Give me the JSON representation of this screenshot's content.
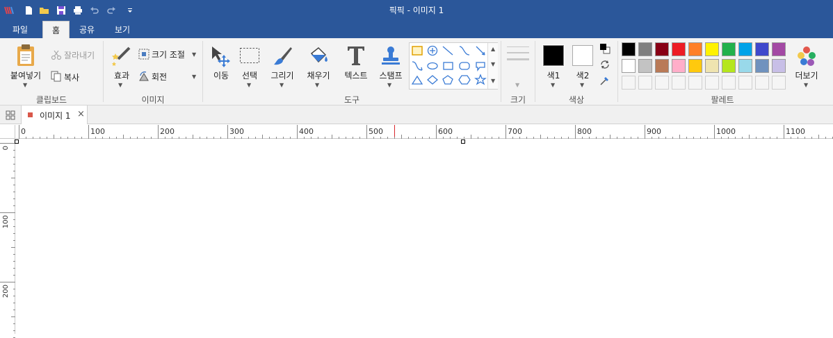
{
  "window": {
    "title": "픽픽 - 이미지 1"
  },
  "quick_access": [
    {
      "name": "app-logo-icon"
    },
    {
      "name": "new-file-icon"
    },
    {
      "name": "open-folder-icon"
    },
    {
      "name": "save-icon"
    },
    {
      "name": "print-icon"
    },
    {
      "name": "undo-icon"
    },
    {
      "name": "redo-icon"
    },
    {
      "name": "customize-dropdown-icon"
    }
  ],
  "tabs": [
    {
      "label": "파일",
      "active": false
    },
    {
      "label": "홈",
      "active": true
    },
    {
      "label": "공유",
      "active": false
    },
    {
      "label": "보기",
      "active": false
    }
  ],
  "ribbon": {
    "clipboard": {
      "group": "클립보드",
      "paste": "붙여넣기",
      "cut": "잘라내기",
      "copy": "복사"
    },
    "image": {
      "group": "이미지",
      "effects": "효과",
      "resize": "크기 조절",
      "rotate": "회전"
    },
    "tools": {
      "group": "도구",
      "move": "이동",
      "select": "선택",
      "draw": "그리기",
      "fill": "채우기",
      "text": "텍스트",
      "stamp": "스탬프"
    },
    "size": {
      "group": "크기"
    },
    "color": {
      "group": "색상",
      "color1": "색1",
      "color2": "색2",
      "color1_value": "#000000",
      "color2_value": "#ffffff"
    },
    "palette": {
      "group": "팔레트",
      "more": "더보기",
      "row1": [
        "#000000",
        "#7f7f7f",
        "#880015",
        "#ed1c24",
        "#ff7f27",
        "#fff200",
        "#22b14c",
        "#00a2e8",
        "#3f48cc",
        "#a349a4"
      ],
      "row2": [
        "#ffffff",
        "#c3c3c3",
        "#b97a57",
        "#ffaec9",
        "#ffc90e",
        "#efe4b0",
        "#b5e61d",
        "#99d9ea",
        "#7092be",
        "#c8bfe7"
      ]
    }
  },
  "document_tab": {
    "label": "이미지 1",
    "close": "×"
  },
  "rulers": {
    "horizontal_labels": [
      "0",
      "100",
      "200",
      "300",
      "400",
      "500",
      "600",
      "700",
      "800",
      "900",
      "1000",
      "1100"
    ],
    "vertical_labels": [
      "0",
      "100",
      "200"
    ]
  },
  "colors": {
    "titlebar": "#2b579a",
    "ribbon": "#f3f3f3",
    "cursor_marker": "#d9262c"
  }
}
